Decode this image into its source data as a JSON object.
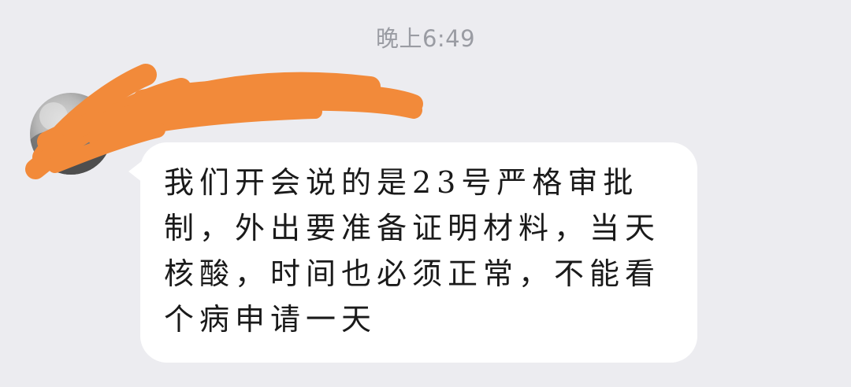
{
  "chat": {
    "timestamp": "晚上6:49",
    "sender_name": "...",
    "message_text": "我们开会说的是23号严格审批制，外出要准备证明材料，当天核酸，时间也必须正常，不能看个病申请一天"
  },
  "colors": {
    "background": "#ececf0",
    "bubble": "#ffffff",
    "timestamp": "#9a9ca3",
    "redaction": "#f28a3a"
  },
  "icons": {
    "avatar": "user-avatar-photo"
  }
}
